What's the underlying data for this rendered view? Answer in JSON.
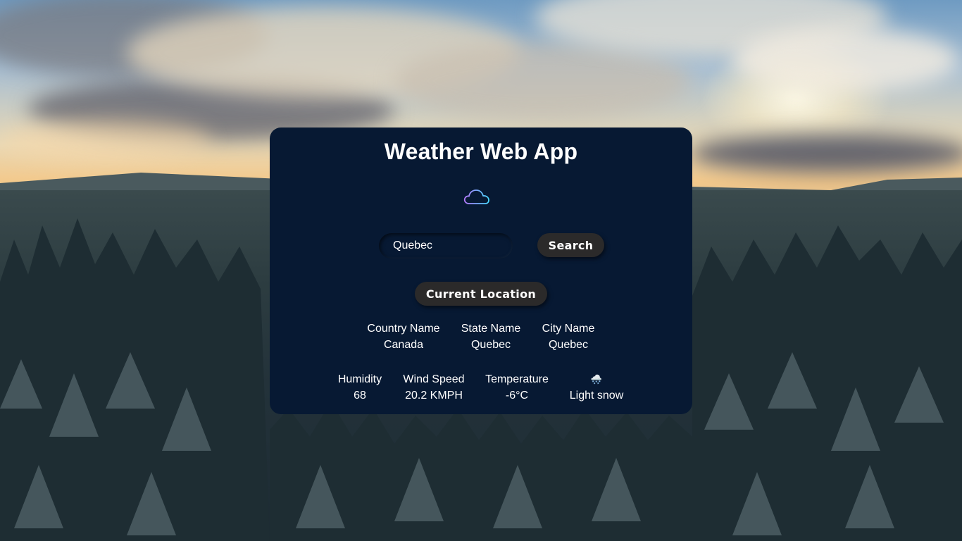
{
  "app": {
    "title": "Weather Web App",
    "logo_icon": "cloud-icon"
  },
  "search": {
    "value": "Quebec",
    "button_label": "Search"
  },
  "location_button": {
    "label": "Current Location"
  },
  "location": {
    "country_label": "Country Name",
    "country_value": "Canada",
    "state_label": "State Name",
    "state_value": "Quebec",
    "city_label": "City Name",
    "city_value": "Quebec"
  },
  "weather": {
    "humidity_label": "Humidity",
    "humidity_value": "68",
    "wind_label": "Wind Speed",
    "wind_value": "20.2 KMPH",
    "temp_label": "Temperature",
    "temp_value": "-6°C",
    "condition_icon": "🌨️",
    "condition_text": "Light snow"
  },
  "colors": {
    "card_bg": "#071933",
    "button_bg": "#2b2a2a",
    "text": "#ffffff"
  }
}
